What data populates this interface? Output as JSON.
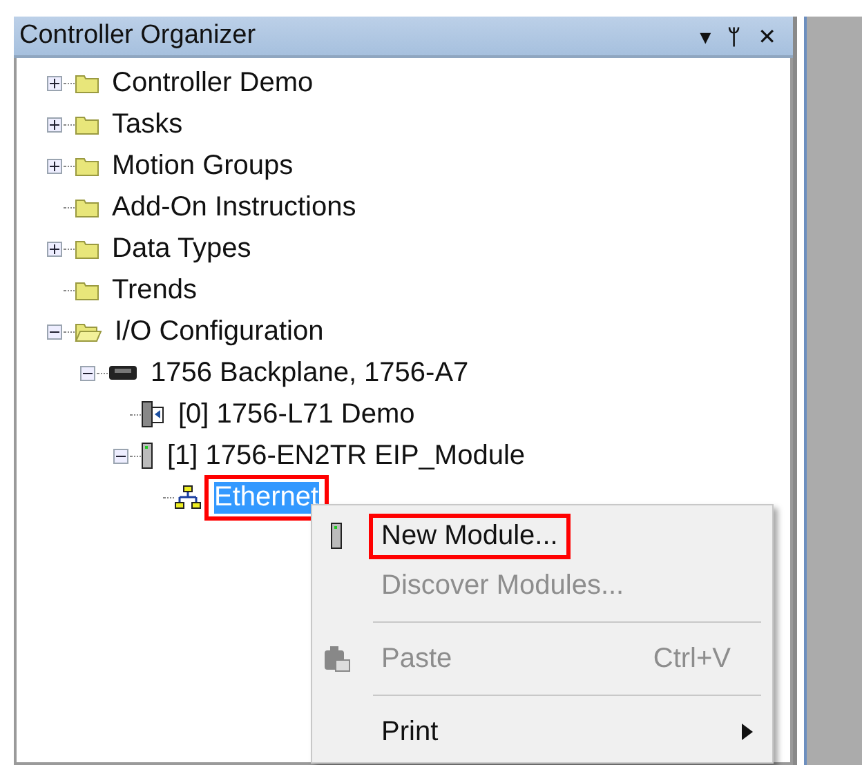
{
  "panel": {
    "title": "Controller Organizer",
    "buttons": [
      "▾",
      "ᛘ",
      "✕"
    ]
  },
  "tree": [
    {
      "label": "Controller Demo",
      "kind": "folder",
      "expanded": false,
      "selected": false,
      "highlighted": false
    },
    {
      "label": "Tasks",
      "kind": "folder",
      "expanded": false,
      "selected": false,
      "highlighted": false
    },
    {
      "label": "Motion Groups",
      "kind": "folder",
      "expanded": false,
      "selected": false,
      "highlighted": false
    },
    {
      "label": "Add-On Instructions",
      "kind": "folder",
      "selected": false,
      "highlighted": false
    },
    {
      "label": "Data Types",
      "kind": "folder",
      "expanded": false,
      "selected": false,
      "highlighted": false
    },
    {
      "label": "Trends",
      "kind": "folder",
      "selected": false,
      "highlighted": false
    },
    {
      "label": "I/O Configuration",
      "kind": "folder",
      "expanded": true,
      "selected": false,
      "highlighted": false,
      "children": [
        {
          "label": "1756 Backplane, 1756-A7",
          "kind": "backplane",
          "expanded": true,
          "selected": false,
          "highlighted": false,
          "children": [
            {
              "label": "[0] 1756-L71 Demo",
              "kind": "controller",
              "selected": false,
              "highlighted": false
            },
            {
              "label": "[1] 1756-EN2TR EIP_Module",
              "kind": "module",
              "expanded": true,
              "selected": false,
              "highlighted": false,
              "children": [
                {
                  "label": "Ethernet",
                  "kind": "network",
                  "selected": true,
                  "highlighted": true
                }
              ]
            }
          ]
        }
      ]
    }
  ],
  "context_menu": [
    {
      "kind": "item",
      "label": "New Module...",
      "disabled": false,
      "highlighted": true
    },
    {
      "kind": "item",
      "label": "Discover Modules...",
      "disabled": true,
      "highlighted": false
    },
    {
      "kind": "separator"
    },
    {
      "kind": "item",
      "label": "Paste",
      "shortcut": "Ctrl+V",
      "disabled": true,
      "highlighted": false
    },
    {
      "kind": "separator"
    },
    {
      "kind": "item",
      "label": "Print",
      "submenu": true,
      "disabled": false,
      "highlighted": false
    }
  ]
}
